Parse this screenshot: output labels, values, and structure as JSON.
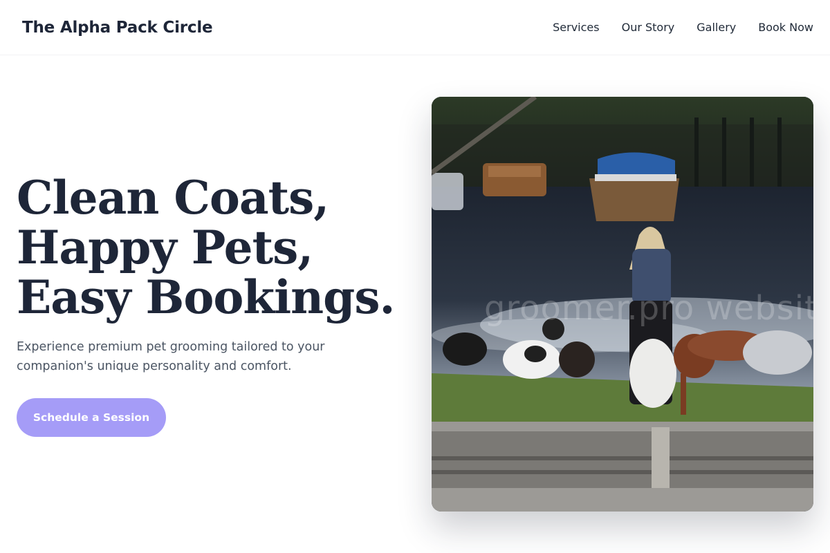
{
  "header": {
    "brand": "The Alpha Pack Circle",
    "nav": [
      "Services",
      "Our Story",
      "Gallery",
      "Book Now"
    ]
  },
  "hero": {
    "headline_lines": [
      "Clean Coats,",
      "Happy Pets,",
      "Easy Bookings."
    ],
    "subtext": "Experience premium pet grooming tailored to your companion's unique personality and comfort.",
    "cta_label": "Schedule a Session"
  },
  "photo": {
    "subject": "woman walking a pack of dogs by the river",
    "watermark": "groomer.pro website"
  },
  "colors": {
    "heading": "#1e2638",
    "body_text": "#4b5563",
    "cta_background": "#a59cf7",
    "cta_text": "#ffffff"
  }
}
